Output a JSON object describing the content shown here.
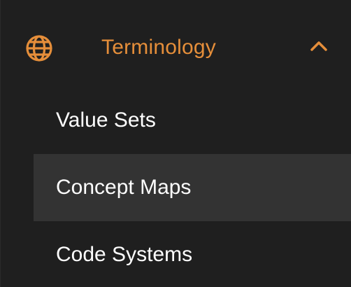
{
  "theme": {
    "background": "#1f1f1f",
    "accent": "#e58e3a",
    "text": "#ffffff",
    "active_item_background": "#333333"
  },
  "section": {
    "title": "Terminology",
    "icon": "globe-icon",
    "toggle_icon": "chevron-up-icon",
    "expanded": true
  },
  "items": [
    {
      "label": "Value Sets",
      "active": false
    },
    {
      "label": "Concept Maps",
      "active": true
    },
    {
      "label": "Code Systems",
      "active": false
    }
  ]
}
